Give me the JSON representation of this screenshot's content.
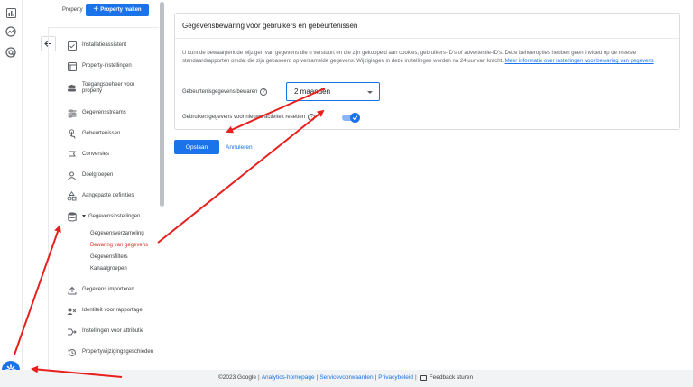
{
  "rail": {
    "icons": [
      "reports-icon",
      "explore-icon",
      "advertising-icon"
    ],
    "settings_icon": "gear-icon"
  },
  "property_header": {
    "label": "Property",
    "create_button": "Property maken"
  },
  "nav": {
    "items": [
      {
        "label": "Installatieassistent",
        "icon": "checklist-icon"
      },
      {
        "label": "Property-instellingen",
        "icon": "property-icon"
      },
      {
        "label": "Toegangsbeheer voor property",
        "icon": "people-icon"
      },
      {
        "label": "Gegevensstreams",
        "icon": "streams-icon"
      },
      {
        "label": "Gebeurtenissen",
        "icon": "touch-icon"
      },
      {
        "label": "Conversies",
        "icon": "flag-icon"
      },
      {
        "label": "Doelgroepen",
        "icon": "audience-icon"
      },
      {
        "label": "Aangepaste definities",
        "icon": "shapes-icon"
      },
      {
        "label": "Gegevensinstellingen",
        "icon": "database-icon"
      },
      {
        "label": "Gegevens importeren",
        "icon": "upload-icon"
      },
      {
        "label": "Identiteit voor rapportage",
        "icon": "identity-icon"
      },
      {
        "label": "Instellingen voor attributie",
        "icon": "attribution-icon"
      },
      {
        "label": "Propertywijzigingsgeschieden",
        "icon": "history-icon"
      }
    ],
    "sub_items": [
      {
        "label": "Gegevensverzameling",
        "active": false
      },
      {
        "label": "Bewaring van gegevens",
        "active": true
      },
      {
        "label": "Gegevensfilters",
        "active": false
      },
      {
        "label": "Kanaalgroepen",
        "active": false
      }
    ]
  },
  "card": {
    "title": "Gegevensbewaring voor gebruikers en gebeurtenissen",
    "description": "U kunt de bewaarperiode wijzigen van gegevens die u verstuurt en die zijn gekoppeld aan cookies, gebruikers-ID's of advertentie-ID's. Deze beheeropties hebben geen invloed op de meeste standaardrapporten omdat die zijn gebaseerd op verzamelde gegevens. Wijzigingen in deze instellingen worden na 24 uur van kracht.",
    "link": "Meer informatie over instellingen voor bewaring van gegevens",
    "event_retention_label": "Gebeurtenisgegevens bewaren",
    "event_retention_value": "2 maanden",
    "reset_label": "Gebruikersgegevens voor nieuwe activiteit resetten",
    "reset_enabled": true
  },
  "actions": {
    "save": "Opslaan",
    "cancel": "Annuleren"
  },
  "footer": {
    "copyright": "©2023 Google",
    "links": [
      "Analytics-homepage",
      "Servicevoorwaarden",
      "Privacybeleid"
    ],
    "feedback": "Feedback sturen"
  },
  "colors": {
    "primary": "#1a73e8",
    "active_nav": "#d93025",
    "annotation": "#e8201d"
  }
}
